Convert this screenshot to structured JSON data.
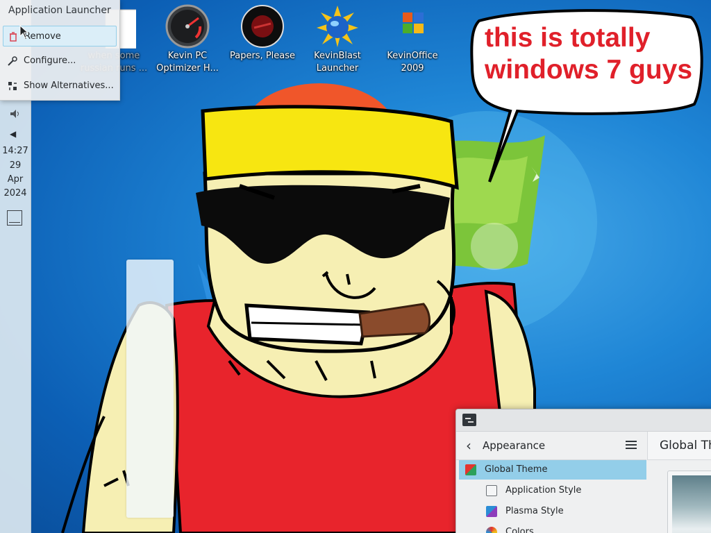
{
  "colors": {
    "desktop_blue": "#1f86d6",
    "bubble_text": "#e0202a",
    "selection": "#93cee9"
  },
  "panel": {
    "clock_time": "14:27",
    "clock_day": "29",
    "clock_month": "Apr",
    "clock_year": "2024"
  },
  "context_menu": {
    "title": "Application Launcher",
    "items": [
      {
        "label": "Remove",
        "icon": "trash-icon"
      },
      {
        "label": "Configure...",
        "icon": "wrench-icon"
      },
      {
        "label": "Show Alternatives...",
        "icon": "alternatives-icon"
      }
    ]
  },
  "desktop_icons": [
    {
      "label": "when some russian runs ...",
      "icon": "file-icon"
    },
    {
      "label": "Kevin PC Optimizer H...",
      "icon": "gauge-icon"
    },
    {
      "label": "Papers, Please",
      "icon": "game-seal-icon"
    },
    {
      "label": "KevinBlast Launcher",
      "icon": "globe-burst-icon"
    },
    {
      "label": "KevinOffice 2009",
      "icon": "office-logo-icon"
    }
  ],
  "speech_bubble": {
    "text": "this is totally\nwindows 7 guys"
  },
  "settings_window": {
    "sidebar_title": "Appearance",
    "content_title": "Global Th",
    "items": [
      {
        "label": "Global Theme",
        "selected": true
      },
      {
        "label": "Application Style",
        "selected": false
      },
      {
        "label": "Plasma Style",
        "selected": false
      },
      {
        "label": "Colors",
        "selected": false
      }
    ]
  }
}
